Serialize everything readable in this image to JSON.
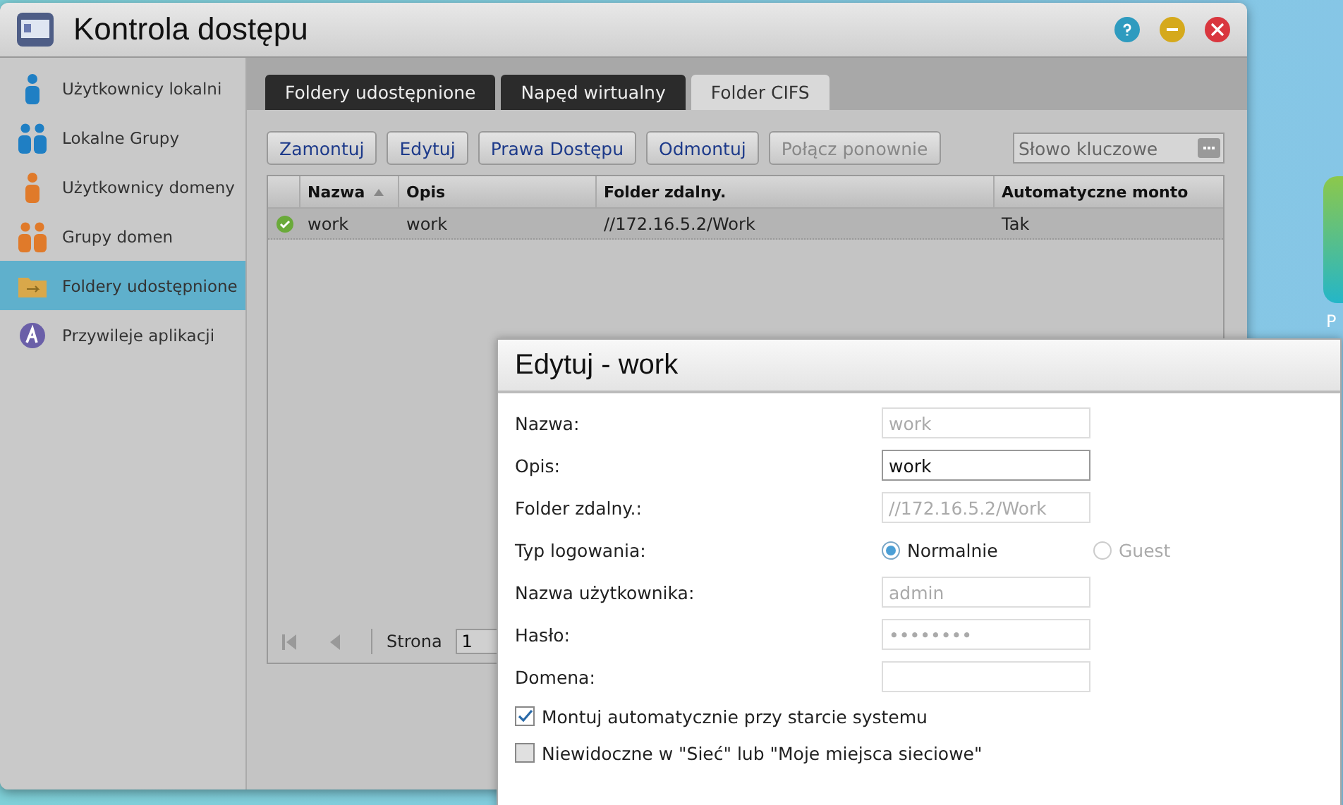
{
  "window": {
    "title": "Kontrola dostępu"
  },
  "sidebar": {
    "items": [
      {
        "label": "Użytkownicy lokalni",
        "kind": "user",
        "color": "#1f7fc4",
        "selected": false
      },
      {
        "label": "Lokalne Grupy",
        "kind": "group",
        "color": "#1f7fc4",
        "selected": false
      },
      {
        "label": "Użytkownicy domeny",
        "kind": "user",
        "color": "#e07a2a",
        "selected": false
      },
      {
        "label": "Grupy domen",
        "kind": "group",
        "color": "#e07a2a",
        "selected": false
      },
      {
        "label": "Foldery udostępnione",
        "kind": "folder",
        "color": "#d9a84a",
        "selected": true
      },
      {
        "label": "Przywileje aplikacji",
        "kind": "app",
        "color": "#6a5fa8",
        "selected": false
      }
    ]
  },
  "tabs": [
    {
      "label": "Foldery udostępnione",
      "selected": false
    },
    {
      "label": "Napęd wirtualny",
      "selected": false
    },
    {
      "label": "Folder CIFS",
      "selected": true
    }
  ],
  "toolbar": {
    "buttons": [
      {
        "label": "Zamontuj",
        "disabled": false
      },
      {
        "label": "Edytuj",
        "disabled": false
      },
      {
        "label": "Prawa Dostępu",
        "disabled": false
      },
      {
        "label": "Odmontuj",
        "disabled": false
      },
      {
        "label": "Połącz ponownie",
        "disabled": true
      }
    ],
    "search": {
      "placeholder": "Słowo kluczowe"
    }
  },
  "table": {
    "columns": [
      {
        "label": "Nazwa",
        "sorted": true
      },
      {
        "label": "Opis",
        "sorted": false
      },
      {
        "label": "Folder zdalny.",
        "sorted": false
      },
      {
        "label": "Automatyczne monto",
        "sorted": false
      }
    ],
    "rows": [
      {
        "mounted": true,
        "selected": true,
        "cells": [
          "work",
          "work",
          "//172.16.5.2/Work",
          "Tak"
        ]
      }
    ]
  },
  "pager": {
    "label": "Strona",
    "page": "1"
  },
  "desktop_icon": {
    "label": "P"
  },
  "dialog": {
    "title": "Edytuj - work",
    "fields": [
      {
        "kind": "input",
        "label": "Nazwa:",
        "value": "work",
        "disabled": true
      },
      {
        "kind": "input",
        "label": "Opis:",
        "value": "work",
        "disabled": false
      },
      {
        "kind": "input",
        "label": "Folder zdalny.:",
        "value": "//172.16.5.2/Work",
        "disabled": true
      },
      {
        "kind": "radio",
        "label": "Typ logowania:",
        "options": [
          {
            "label": "Normalnie",
            "selected": true,
            "disabled": false
          },
          {
            "label": "Guest",
            "selected": false,
            "disabled": true
          }
        ]
      },
      {
        "kind": "input",
        "label": "Nazwa użytkownika:",
        "value": "admin",
        "disabled": true
      },
      {
        "kind": "input",
        "label": "Hasło:",
        "value": "••••••••",
        "disabled": true
      },
      {
        "kind": "input",
        "label": "Domena:",
        "disabled": true
      }
    ],
    "checkboxes": [
      {
        "label": "Montuj automatycznie przy starcie systemu",
        "checked": true
      },
      {
        "label": "Niewidoczne w \"Sieć\" lub \"Moje miejsca sieciowe\"",
        "checked": false
      }
    ]
  }
}
